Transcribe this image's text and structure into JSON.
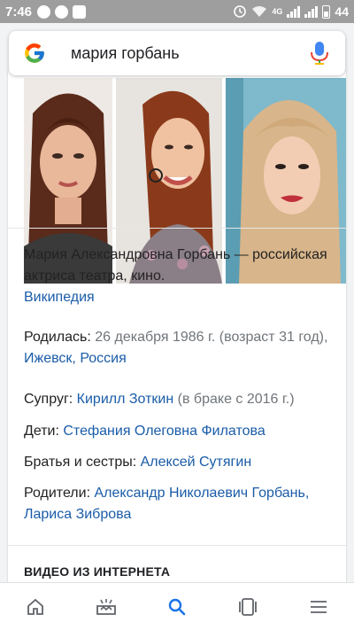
{
  "status_bar": {
    "time": "7:46",
    "network": "4G",
    "battery_percent": "44"
  },
  "search": {
    "query": "мария горбань"
  },
  "description": {
    "text": "Мария Александровна Горбань — российская актриса театра, кино.",
    "source_link": "Википедия"
  },
  "facts": {
    "born": {
      "label": "Родилась:",
      "value": "26 декабря 1986 г. (возраст 31 год),",
      "place_link": "Ижевск, Россия"
    },
    "spouse": {
      "label": "Супруг:",
      "link": "Кирилл Зоткин",
      "note": "(в браке с 2016 г.)"
    },
    "children": {
      "label": "Дети:",
      "link": "Стефания Олеговна Филатова"
    },
    "siblings": {
      "label": "Братья и сестры:",
      "link": "Алексей Сутягин"
    },
    "parents": {
      "label": "Родители:",
      "link1": "Александр Николаевич Горбань,",
      "link2": "Лариса Зиброва"
    }
  },
  "videos_section": {
    "title": "ВИДЕО ИЗ ИНТЕРНЕТА"
  },
  "colors": {
    "link": "#1a5ca8",
    "accent_blue": "#4285f4"
  },
  "bottom_nav": [
    {
      "icon": "home-icon"
    },
    {
      "icon": "updates-icon"
    },
    {
      "icon": "search-icon",
      "active": true
    },
    {
      "icon": "tabs-icon"
    },
    {
      "icon": "menu-icon"
    }
  ]
}
